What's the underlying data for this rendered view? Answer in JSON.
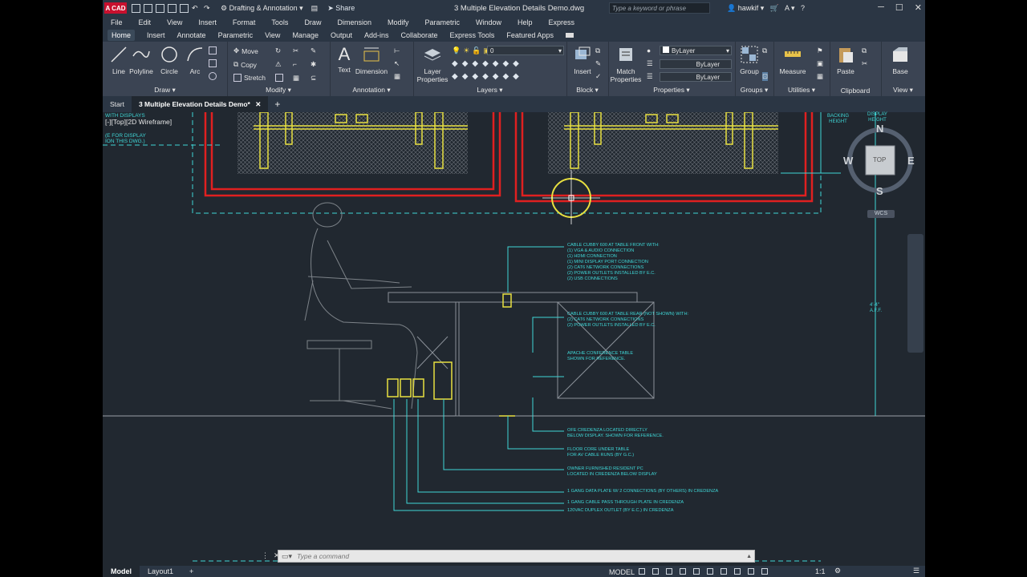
{
  "app": {
    "logo_text": "A CAD",
    "workspace": "Drafting & Annotation",
    "share_label": "Share",
    "document_title": "3 Multiple Elevation Details Demo.dwg",
    "search_placeholder": "Type a keyword or phrase",
    "username": "hawkif"
  },
  "menu": [
    "File",
    "Edit",
    "View",
    "Insert",
    "Format",
    "Tools",
    "Draw",
    "Dimension",
    "Modify",
    "Parametric",
    "Window",
    "Help",
    "Express"
  ],
  "ribbon_tabs": [
    "Home",
    "Insert",
    "Annotate",
    "Parametric",
    "View",
    "Manage",
    "Output",
    "Add-ins",
    "Collaborate",
    "Express Tools",
    "Featured Apps"
  ],
  "ribbon": {
    "draw": {
      "line": "Line",
      "polyline": "Polyline",
      "circle": "Circle",
      "arc": "Arc",
      "label": "Draw"
    },
    "modify": {
      "move": "Move",
      "copy": "Copy",
      "stretch": "Stretch",
      "label": "Modify"
    },
    "annotation": {
      "text": "Text",
      "dimension": "Dimension",
      "label": "Annotation"
    },
    "layers": {
      "layer_properties": "Layer Properties",
      "current_layer": "0",
      "label": "Layers"
    },
    "block": {
      "insert": "Insert",
      "label": "Block"
    },
    "properties": {
      "match": "Match Properties",
      "color": "ByLayer",
      "linetype": "ByLayer",
      "lineweight": "ByLayer",
      "label": "Properties"
    },
    "groups": {
      "group": "Group",
      "label": "Groups"
    },
    "utilities": {
      "measure": "Measure",
      "label": "Utilities"
    },
    "clipboard": {
      "paste": "Paste",
      "label": "Clipboard"
    },
    "view": {
      "base": "Base",
      "label": "View"
    }
  },
  "file_tabs": {
    "start": "Start",
    "active": "3 Multiple Elevation Details Demo*"
  },
  "viewport_label": "[-][Top][2D Wireframe]",
  "viewcube": {
    "top": "TOP",
    "n": "N",
    "s": "S",
    "e": "E",
    "w": "W",
    "wcs": "WCS"
  },
  "drawing_notes": {
    "cubby_front": [
      "CABLE CUBBY 600 AT TABLE FRONT WITH:",
      "(1) VGA & AUDIO CONNECTION",
      "(1) HDMI CONNECTION",
      "(1) MINI DISPLAY PORT CONNECTION",
      "(2) CAT6 NETWORK CONNECTIONS",
      "(2) POWER OUTLETS INSTALLED BY E.C.",
      "(2) USB CONNECTIONS"
    ],
    "cubby_rear": [
      "CABLE CUBBY 600 AT TABLE REAR (NOT SHOWN) WITH:",
      "(2) CAT6 NETWORK CONNECTIONS",
      "(2) POWER OUTLETS INSTALLED BY E.C."
    ],
    "table": [
      "APACHE CONFERENCE TABLE",
      "SHOWN FOR REFERENCE."
    ],
    "credenza": [
      "OFE CREDENZA LOCATED DIRECTLY",
      "BELOW DISPLAY.  SHOWN FOR REFERENCE."
    ],
    "floor_core": [
      "FLOOR CORE UNDER TABLE",
      "FOR AV CABLE RUNS (BY G.C.)"
    ],
    "pc": [
      "OWNER FURNISHED RESIDENT PC",
      "LOCATED IN CREDENZA BELOW DISPLAY"
    ],
    "data_plate": "1 GANG DATA PLATE W/ 2 CONNECTIONS (BY OTHERS) IN CREDENZA",
    "pass_through": "1 GANG CABLE PASS THROUGH PLATE IN CREDENZA",
    "duplex": "120VAC DUPLEX OUTLET (BY E.C.) IN CREDENZA",
    "left_note1": "WITH DISPLAYS",
    "left_note2": "(E FOR DISPLAY",
    "left_note3": "ION THIS DWG.)",
    "backing": [
      "BACKING",
      "HEIGHT"
    ],
    "display": [
      "DISPLAY",
      "HEIGHT"
    ],
    "dim_aff": [
      "4'-4\"",
      "A.F.F."
    ]
  },
  "command": {
    "placeholder": "Type a command"
  },
  "status": {
    "model_tab": "Model",
    "layout_tab": "Layout1",
    "model_button": "MODEL",
    "scale": "1:1"
  }
}
